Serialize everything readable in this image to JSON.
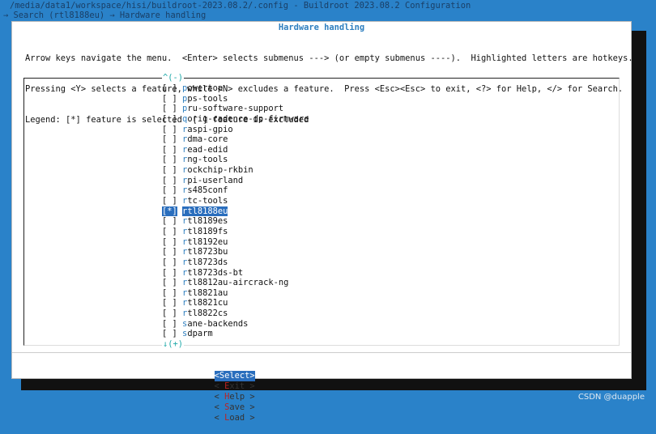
{
  "window": {
    "path_line": "/media/data1/workspace/hisi/buildroot-2023.08.2/.config - Buildroot 2023.08.2 Configuration",
    "breadcrumb": "→ Search (rtl8188eu) → Hardware handling"
  },
  "dialog": {
    "title": "Hardware handling",
    "help_lines": [
      "Arrow keys navigate the menu.  <Enter> selects submenus ---> (or empty submenus ----).  Highlighted letters are hotkeys.",
      "Pressing <Y> selects a feature, while <N> excludes a feature.  Press <Esc><Esc> to exit, <?> for Help, </> for Search.",
      "Legend: [*] feature is selected  [ ] feature is excluded"
    ],
    "scroll_up": "^(-)",
    "scroll_down": "↓(+)"
  },
  "menu": {
    "items": [
      {
        "check": "[ ]",
        "hot": "p",
        "rest": "owertop",
        "selected": false
      },
      {
        "check": "[ ]",
        "hot": "p",
        "rest": "ps-tools",
        "selected": false
      },
      {
        "check": "[ ]",
        "hot": "p",
        "rest": "ru-software-support",
        "selected": false
      },
      {
        "check": "[ ]",
        "hot": "q",
        "rest": "oriq-cadence-dp-firmware",
        "selected": false
      },
      {
        "check": "[ ]",
        "hot": "r",
        "rest": "aspi-gpio",
        "selected": false
      },
      {
        "check": "[ ]",
        "hot": "r",
        "rest": "dma-core",
        "selected": false
      },
      {
        "check": "[ ]",
        "hot": "r",
        "rest": "ead-edid",
        "selected": false
      },
      {
        "check": "[ ]",
        "hot": "r",
        "rest": "ng-tools",
        "selected": false
      },
      {
        "check": "[ ]",
        "hot": "r",
        "rest": "ockchip-rkbin",
        "selected": false
      },
      {
        "check": "[ ]",
        "hot": "r",
        "rest": "pi-userland",
        "selected": false
      },
      {
        "check": "[ ]",
        "hot": "r",
        "rest": "s485conf",
        "selected": false
      },
      {
        "check": "[ ]",
        "hot": "r",
        "rest": "tc-tools",
        "selected": false
      },
      {
        "check": "[*]",
        "hot": "r",
        "rest": "tl8188eu",
        "selected": true
      },
      {
        "check": "[ ]",
        "hot": "r",
        "rest": "tl8189es",
        "selected": false
      },
      {
        "check": "[ ]",
        "hot": "r",
        "rest": "tl8189fs",
        "selected": false
      },
      {
        "check": "[ ]",
        "hot": "r",
        "rest": "tl8192eu",
        "selected": false
      },
      {
        "check": "[ ]",
        "hot": "r",
        "rest": "tl8723bu",
        "selected": false
      },
      {
        "check": "[ ]",
        "hot": "r",
        "rest": "tl8723ds",
        "selected": false
      },
      {
        "check": "[ ]",
        "hot": "r",
        "rest": "tl8723ds-bt",
        "selected": false
      },
      {
        "check": "[ ]",
        "hot": "r",
        "rest": "tl8812au-aircrack-ng",
        "selected": false
      },
      {
        "check": "[ ]",
        "hot": "r",
        "rest": "tl8821au",
        "selected": false
      },
      {
        "check": "[ ]",
        "hot": "r",
        "rest": "tl8821cu",
        "selected": false
      },
      {
        "check": "[ ]",
        "hot": "r",
        "rest": "tl8822cs",
        "selected": false
      },
      {
        "check": "[ ]",
        "hot": "s",
        "rest": "ane-backends",
        "selected": false
      },
      {
        "check": "[ ]",
        "hot": "s",
        "rest": "dparm",
        "selected": false
      }
    ]
  },
  "buttons": {
    "select": {
      "pre": "<",
      "hot": "S",
      "rest": "elect>"
    },
    "exit": {
      "pre": "< ",
      "hot": "E",
      "rest": "xit >"
    },
    "help": {
      "pre": "< ",
      "hot": "H",
      "rest": "elp >"
    },
    "save": {
      "pre": "< ",
      "hot": "S",
      "rest": "ave >"
    },
    "load": {
      "pre": "< ",
      "hot": "L",
      "rest": "oad >"
    }
  },
  "watermark": "CSDN @duapple"
}
